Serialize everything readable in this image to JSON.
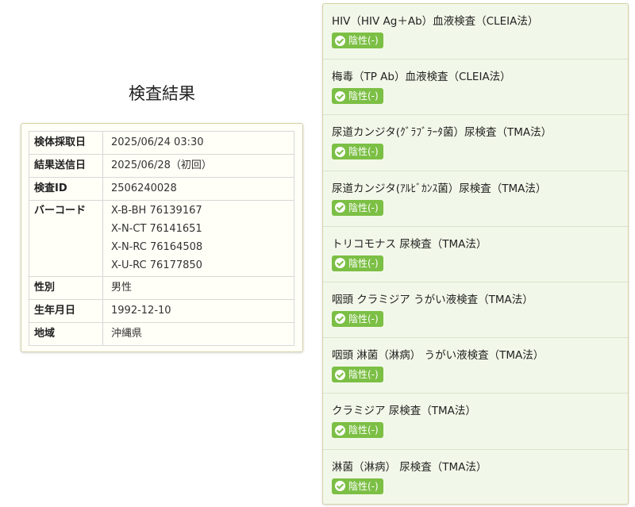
{
  "page_title": "検査結果",
  "info": {
    "rows": [
      {
        "label": "検体採取日",
        "value": "2025/06/24 03:30"
      },
      {
        "label": "結果送信日",
        "value": "2025/06/28（初回）"
      },
      {
        "label": "検査ID",
        "value": "2506240028"
      },
      {
        "label": "バーコード",
        "values": [
          "X-B-BH 76139167",
          "X-N-CT 76141651",
          "X-N-RC 76164508",
          "X-U-RC 76177850"
        ]
      },
      {
        "label": "性別",
        "value": "男性"
      },
      {
        "label": "生年月日",
        "value": "1992-12-10"
      },
      {
        "label": "地域",
        "value": "沖縄県"
      }
    ]
  },
  "results": [
    {
      "name": "HIV（HIV Ag＋Ab）血液検査（CLEIA法）",
      "status": "陰性(-)"
    },
    {
      "name": "梅毒（TP Ab）血液検査（CLEIA法）",
      "status": "陰性(-)"
    },
    {
      "name": "尿道カンジタ(ｸﾞﾗﾌﾞﾗｰﾀ菌）尿検査（TMA法）",
      "status": "陰性(-)"
    },
    {
      "name": "尿道カンジタ(ｱﾙﾋﾞｶﾝｽ菌）尿検査（TMA法）",
      "status": "陰性(-)"
    },
    {
      "name": "トリコモナス 尿検査（TMA法）",
      "status": "陰性(-)"
    },
    {
      "name": "咽頭 クラミジア うがい液検査（TMA法）",
      "status": "陰性(-)"
    },
    {
      "name": "咽頭 淋菌（淋病） うがい液検査（TMA法）",
      "status": "陰性(-)"
    },
    {
      "name": "クラミジア 尿検査（TMA法）",
      "status": "陰性(-)"
    },
    {
      "name": "淋菌（淋病） 尿検査（TMA法）",
      "status": "陰性(-)"
    }
  ],
  "colors": {
    "badge": "#7cbf45",
    "results_bg": "#f2f8e9"
  },
  "icons": {
    "badge_icon": "check-circle-icon"
  }
}
